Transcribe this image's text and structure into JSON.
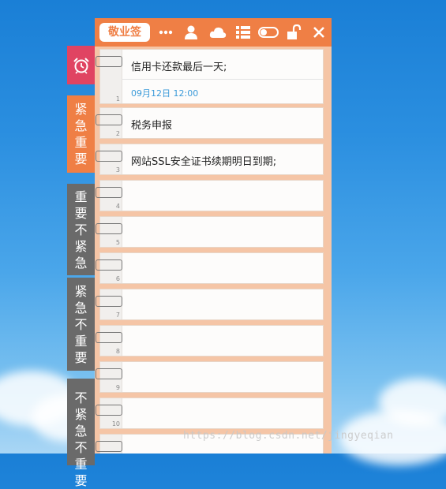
{
  "header": {
    "title": "敬业签",
    "accent": "#ef7f45",
    "icons": [
      "more-icon",
      "user-icon",
      "cloud-icon",
      "list-icon",
      "toggle-icon",
      "unlock-icon",
      "close-icon"
    ]
  },
  "tabs": [
    {
      "icon": "alarm-clock-icon",
      "color": "#e04462"
    },
    {
      "label": "紧急重要",
      "color": "#ef7f45"
    },
    {
      "label": "重要不紧急",
      "color": "#6a6a6a"
    },
    {
      "label": "紧急不重要",
      "color": "#6a6a6a"
    },
    {
      "label": "不紧急不重要",
      "color": "#6a6a6a"
    }
  ],
  "notes": [
    {
      "num": "1",
      "text": "信用卡还款最后一天;",
      "date": "09月12日 12:00"
    },
    {
      "num": "2",
      "text": "税务申报"
    },
    {
      "num": "3",
      "text": "网站SSL安全证书续期明日到期;"
    },
    {
      "num": "4",
      "text": ""
    },
    {
      "num": "5",
      "text": ""
    },
    {
      "num": "6",
      "text": ""
    },
    {
      "num": "7",
      "text": ""
    },
    {
      "num": "8",
      "text": ""
    },
    {
      "num": "9",
      "text": ""
    },
    {
      "num": "10",
      "text": ""
    },
    {
      "num": "",
      "text": ""
    }
  ],
  "watermark": "https://blog.csdn.net/jingyeqian"
}
